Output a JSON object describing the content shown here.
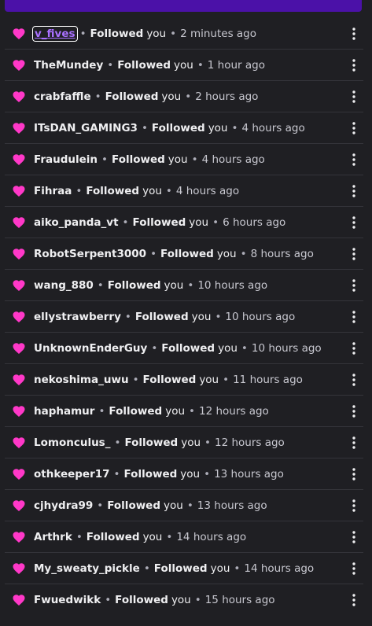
{
  "colors": {
    "heart": "#ff38c8",
    "accent": "#4b11a8",
    "link_selected": "#a970ff"
  },
  "icons": {
    "heart": "heart-icon",
    "menu": "more-vertical-icon"
  },
  "notifications": [
    {
      "username": "v_fives",
      "action": "Followed",
      "object": "you",
      "time": "2 minutes ago"
    },
    {
      "username": "TheMundey",
      "action": "Followed",
      "object": "you",
      "time": "1 hour ago"
    },
    {
      "username": "crabfaffle",
      "action": "Followed",
      "object": "you",
      "time": "2 hours ago"
    },
    {
      "username": "ITsDAN_GAMING3",
      "action": "Followed",
      "object": "you",
      "time": "4 hours ago"
    },
    {
      "username": "Fraudulein",
      "action": "Followed",
      "object": "you",
      "time": "4 hours ago"
    },
    {
      "username": "Fihraa",
      "action": "Followed",
      "object": "you",
      "time": "4 hours ago"
    },
    {
      "username": "aiko_panda_vt",
      "action": "Followed",
      "object": "you",
      "time": "6 hours ago"
    },
    {
      "username": "RobotSerpent3000",
      "action": "Followed",
      "object": "you",
      "time": "8 hours ago"
    },
    {
      "username": "wang_880",
      "action": "Followed",
      "object": "you",
      "time": "10 hours ago"
    },
    {
      "username": "ellystrawberry",
      "action": "Followed",
      "object": "you",
      "time": "10 hours ago"
    },
    {
      "username": "UnknownEnderGuy",
      "action": "Followed",
      "object": "you",
      "time": "10 hours ago"
    },
    {
      "username": "nekoshima_uwu",
      "action": "Followed",
      "object": "you",
      "time": "11 hours ago"
    },
    {
      "username": "haphamur",
      "action": "Followed",
      "object": "you",
      "time": "12 hours ago"
    },
    {
      "username": "Lomonculus_",
      "action": "Followed",
      "object": "you",
      "time": "12 hours ago"
    },
    {
      "username": "othkeeper17",
      "action": "Followed",
      "object": "you",
      "time": "13 hours ago"
    },
    {
      "username": "cjhydra99",
      "action": "Followed",
      "object": "you",
      "time": "13 hours ago"
    },
    {
      "username": "Arthrk",
      "action": "Followed",
      "object": "you",
      "time": "14 hours ago"
    },
    {
      "username": "My_sweaty_pickle",
      "action": "Followed",
      "object": "you",
      "time": "14 hours ago"
    },
    {
      "username": "Fwuedwikk",
      "action": "Followed",
      "object": "you",
      "time": "15 hours ago"
    }
  ]
}
